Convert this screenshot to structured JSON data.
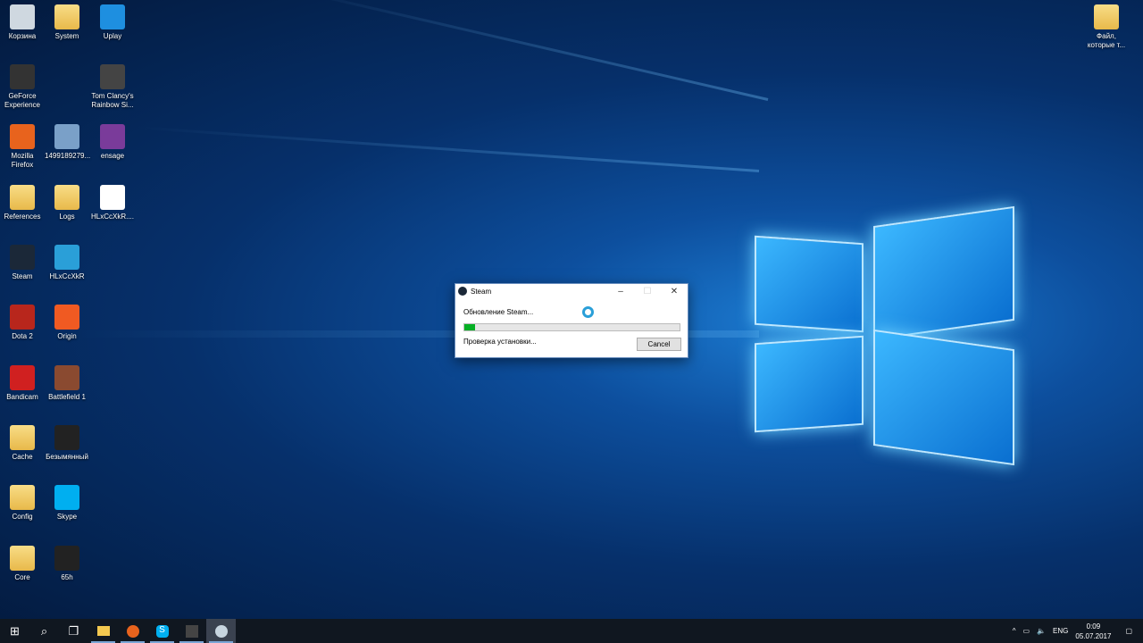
{
  "desktop": {
    "icons": [
      {
        "label": "Корзина",
        "glyph": "recycle-bin-icon"
      },
      {
        "label": "System",
        "glyph": "folder-icon"
      },
      {
        "label": "Uplay",
        "glyph": "uplay-icon"
      },
      {
        "label": "GeForce Experience",
        "glyph": "geforce-icon"
      },
      {
        "label": "Tom Clancy's Rainbow Si...",
        "glyph": "rainbow-six-icon"
      },
      {
        "label": "Mozilla Firefox",
        "glyph": "firefox-icon"
      },
      {
        "label": "1499189279...",
        "glyph": "installer-icon"
      },
      {
        "label": "ensage",
        "glyph": "winrar-icon"
      },
      {
        "label": "References",
        "glyph": "folder-icon"
      },
      {
        "label": "Logs",
        "glyph": "folder-icon"
      },
      {
        "label": "HLxCcXkR....",
        "glyph": "file-icon"
      },
      {
        "label": "Steam",
        "glyph": "steam-icon"
      },
      {
        "label": "HLxCcXkR",
        "glyph": "app-icon"
      },
      {
        "label": "Dota 2",
        "glyph": "dota-icon"
      },
      {
        "label": "Origin",
        "glyph": "origin-icon"
      },
      {
        "label": "Bandicam",
        "glyph": "bandicam-icon"
      },
      {
        "label": "Battlefield 1",
        "glyph": "battlefield-icon"
      },
      {
        "label": "Cache",
        "glyph": "folder-icon"
      },
      {
        "label": "Безымянный",
        "glyph": "image-icon"
      },
      {
        "label": "Config",
        "glyph": "folder-icon"
      },
      {
        "label": "Skype",
        "glyph": "skype-icon"
      },
      {
        "label": "Core",
        "glyph": "folder-icon"
      },
      {
        "label": "65h",
        "glyph": "image-icon"
      },
      {
        "label": "Файл, которые т...",
        "glyph": "folder-icon"
      }
    ]
  },
  "dialog": {
    "title": "Steam",
    "status": "Обновление Steam...",
    "progress_percent": 5,
    "detail": "Проверка установки...",
    "cancel_label": "Cancel",
    "minimize": "–",
    "maximize": "☐",
    "close": "✕"
  },
  "taskbar": {
    "lang": "ENG",
    "time": "0:09",
    "date": "05.07.2017",
    "accent": "#06b025"
  }
}
